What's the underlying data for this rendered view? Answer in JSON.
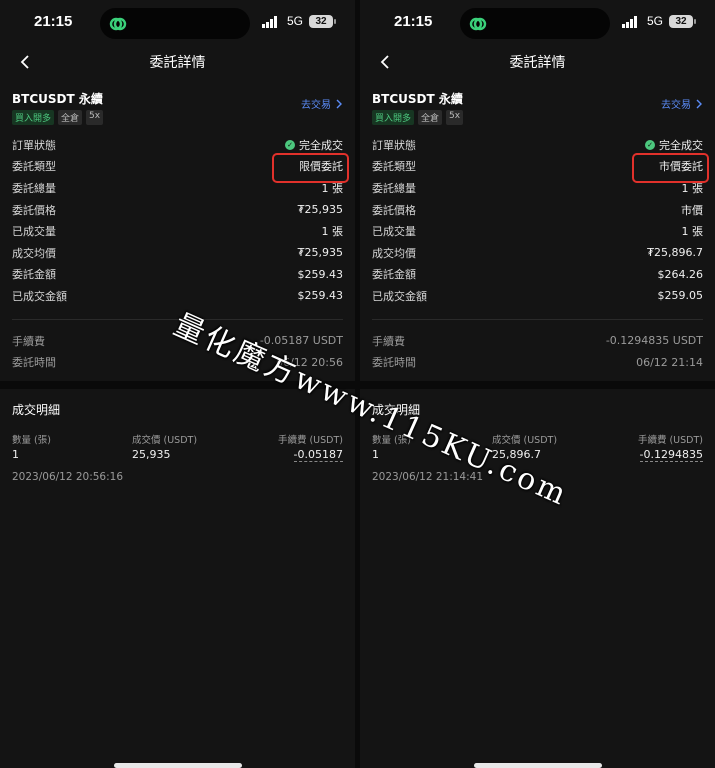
{
  "status": {
    "time": "21:15",
    "network": "5G",
    "battery": "32"
  },
  "nav": {
    "title": "委託詳情"
  },
  "watermark": "量化魔方www.115KU.com",
  "icons": {
    "back": "chevron-left-icon",
    "link_arrow": "chevron-right-icon",
    "island": "app-link-icon",
    "success": "check-circle-icon"
  },
  "colors": {
    "accent_blue": "#5b8cf7",
    "green": "#4cc77e",
    "highlight_red": "#e1312b"
  },
  "panels": [
    {
      "symbol": "BTCUSDT 永續",
      "tags": [
        "買入開多",
        "全倉",
        "5x"
      ],
      "trade_link": "去交易",
      "rows": [
        {
          "label": "訂單狀態",
          "value": "完全成交"
        },
        {
          "label": "委託類型",
          "value": "限價委託"
        },
        {
          "label": "委託總量",
          "value": "1 張"
        },
        {
          "label": "委託價格",
          "value": "₮25,935"
        },
        {
          "label": "已成交量",
          "value": "1 張"
        },
        {
          "label": "成交均價",
          "value": "₮25,935"
        },
        {
          "label": "委託金額",
          "value": "$259.43"
        },
        {
          "label": "已成交金額",
          "value": "$259.43"
        }
      ],
      "rows2": [
        {
          "label": "手續費",
          "value": "-0.05187 USDT"
        },
        {
          "label": "委託時間",
          "value": "06/12 20:56"
        }
      ],
      "detail": {
        "title": "成交明細",
        "headers": [
          "數量 (張)",
          "成交價 (USDT)",
          "手續費 (USDT)"
        ],
        "values": [
          "1",
          "25,935",
          "-0.05187"
        ],
        "time": "2023/06/12 20:56:16"
      }
    },
    {
      "symbol": "BTCUSDT 永續",
      "tags": [
        "買入開多",
        "全倉",
        "5x"
      ],
      "trade_link": "去交易",
      "rows": [
        {
          "label": "訂單狀態",
          "value": "完全成交"
        },
        {
          "label": "委託類型",
          "value": "市價委託"
        },
        {
          "label": "委託總量",
          "value": "1 張"
        },
        {
          "label": "委託價格",
          "value": "市價"
        },
        {
          "label": "已成交量",
          "value": "1 張"
        },
        {
          "label": "成交均價",
          "value": "₮25,896.7"
        },
        {
          "label": "委託金額",
          "value": "$264.26"
        },
        {
          "label": "已成交金額",
          "value": "$259.05"
        }
      ],
      "rows2": [
        {
          "label": "手續費",
          "value": "-0.1294835 USDT"
        },
        {
          "label": "委託時間",
          "value": "06/12 21:14"
        }
      ],
      "detail": {
        "title": "成交明細",
        "headers": [
          "數量 (張)",
          "成交價 (USDT)",
          "手續費 (USDT)"
        ],
        "values": [
          "1",
          "25,896.7",
          "-0.1294835"
        ],
        "time": "2023/06/12 21:14:41"
      }
    }
  ]
}
